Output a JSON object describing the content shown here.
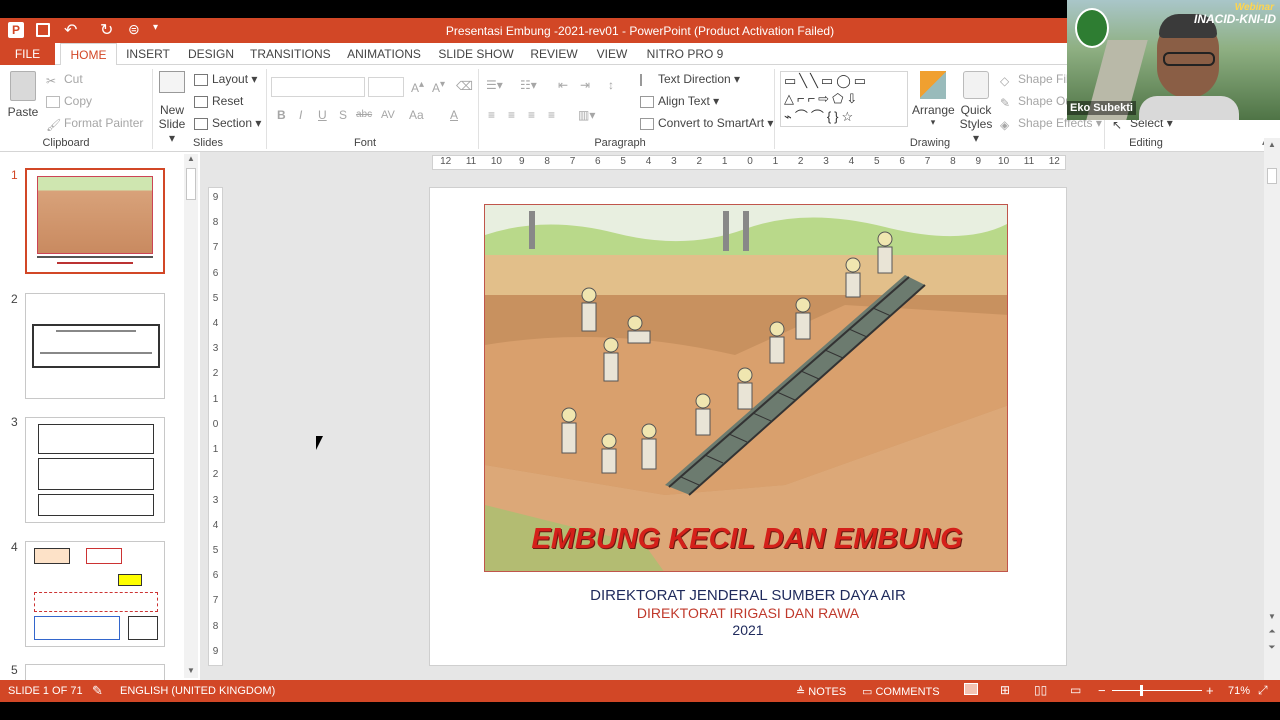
{
  "window": {
    "title": "Presentasi Embung -2021-rev01 -  PowerPoint (Product Activation Failed)"
  },
  "tabs": [
    "FILE",
    "HOME",
    "INSERT",
    "DESIGN",
    "TRANSITIONS",
    "ANIMATIONS",
    "SLIDE SHOW",
    "REVIEW",
    "VIEW",
    "NITRO PRO 9"
  ],
  "ribbon": {
    "clipboard": {
      "paste": "Paste",
      "cut": "Cut",
      "copy": "Copy",
      "format_painter": "Format Painter",
      "label": "Clipboard"
    },
    "slides": {
      "new_slide_1": "New",
      "new_slide_2": "Slide",
      "layout": "Layout",
      "reset": "Reset",
      "section": "Section",
      "label": "Slides"
    },
    "font": {
      "label": "Font",
      "bold": "B",
      "italic": "I",
      "underline": "U",
      "shadow": "S",
      "strike": "abc",
      "spacing": "AV",
      "case": "Aa",
      "color": "A"
    },
    "paragraph": {
      "text_direction": "Text Direction",
      "align_text": "Align Text",
      "convert": "Convert to SmartArt",
      "label": "Paragraph"
    },
    "drawing": {
      "arrange": "Arrange",
      "quick_1": "Quick",
      "quick_2": "Styles",
      "shape_fill": "Shape Fill",
      "shape_outline": "Shape Ou",
      "shape_effects": "Shape Effects",
      "label": "Drawing"
    },
    "editing": {
      "select": "Select",
      "label": "Editing"
    }
  },
  "ruler": {
    "h_ticks": [
      "12",
      "11",
      "10",
      "9",
      "8",
      "7",
      "6",
      "5",
      "4",
      "3",
      "2",
      "1",
      "0",
      "1",
      "2",
      "3",
      "4",
      "5",
      "6",
      "7",
      "8",
      "9",
      "10",
      "11",
      "12"
    ],
    "v_ticks": [
      "9",
      "8",
      "7",
      "6",
      "5",
      "4",
      "3",
      "2",
      "1",
      "0",
      "1",
      "2",
      "3",
      "4",
      "5",
      "6",
      "7",
      "8",
      "9"
    ]
  },
  "thumbnails": [
    {
      "num": "1",
      "selected": true
    },
    {
      "num": "2",
      "selected": false
    },
    {
      "num": "3",
      "selected": false
    },
    {
      "num": "4",
      "selected": false
    },
    {
      "num": "5",
      "selected": false
    }
  ],
  "slide": {
    "banner": "EMBUNG KECIL DAN EMBUNG",
    "line1": "DIREKTORAT JENDERAL SUMBER DAYA AIR",
    "line2": "DIREKTORAT IRIGASI DAN RAWA",
    "line3": "2021"
  },
  "status": {
    "slide_count": "SLIDE 1 OF 71",
    "language": "ENGLISH (UNITED KINGDOM)",
    "notes": "NOTES",
    "comments": "COMMENTS",
    "zoom": "71%"
  },
  "video": {
    "name": "Eko Subekti",
    "watermark_top": "Webinar",
    "watermark_main": "INACID-KNI-ID"
  },
  "colors": {
    "accent": "#d24726",
    "navy": "#1f2a5c",
    "banner_red": "#d4201a"
  }
}
